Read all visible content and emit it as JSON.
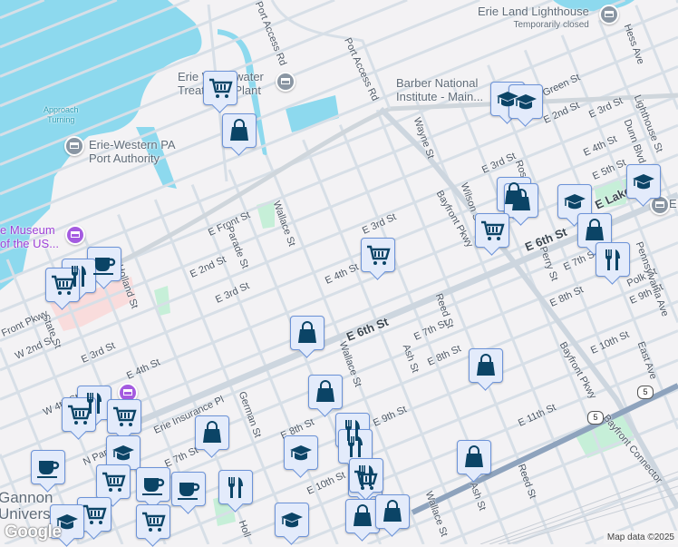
{
  "streets": [
    "Port Access Rd",
    "Port Access Rd",
    "E Front St",
    "Parade St",
    "Wallace St",
    "E 2nd St",
    "E 3rd St",
    "E 4th St",
    "E 3rd St",
    "Holland St",
    "State St",
    "W 2nd St",
    "E 3rd St",
    "E 4th St",
    "Erie Insurance Pl",
    "E 6th St",
    "German St",
    "E 8th St",
    "E 7th St",
    "Wallace St",
    "Ash St",
    "Reed St",
    "E 7th St",
    "E 8th St",
    "E 9th St",
    "E 10th St",
    "E 11th St",
    "Wayne St",
    "Wilson St",
    "Ross St",
    "Bayfront Pkwy",
    "E 6th St",
    "Perry St",
    "E 7th St",
    "E 8th St",
    "Polk St",
    "E 9th St",
    "E 10th St",
    "Bayfront Pkwy",
    "East Ave",
    "Bayfront Connector",
    "Reed St",
    "Ash St",
    "Wallace St",
    "E 3rd St",
    "E 4th St",
    "E 5th St",
    "E 3rd St",
    "E 2nd St",
    "Green St",
    "Dunn Blvd",
    "Lighthouse St",
    "Hess Ave",
    "E Lake Rd",
    "Pennsylvania Ave",
    "N Park",
    "Holl",
    "Front Pkwy",
    "W 4th St"
  ],
  "places": {
    "water_plant": [
      "Erie Wastewater",
      "Treatment Plant"
    ],
    "port_authority": [
      "Erie-Western PA",
      "Port Authority"
    ],
    "approach": [
      "Approach",
      "Turning"
    ],
    "museum": [
      "e Museum",
      "of the US..."
    ],
    "barber": [
      "Barber National",
      "Institute - Main..."
    ],
    "lighthouse": "Erie Land Lighthouse",
    "lighthouse_status": "Temporarily closed",
    "gannon": [
      "Gannon",
      "University"
    ],
    "edge_e": "E"
  },
  "route_shields": [
    "5",
    "5"
  ],
  "markers": [
    "cart",
    "bag",
    "edu",
    "edu",
    "bag",
    "bag",
    "edu",
    "edu",
    "cart",
    "bag",
    "food",
    "cart",
    "coffee",
    "food",
    "cart",
    "bag",
    "bag",
    "bag",
    "food",
    "food",
    "bag",
    "edu",
    "food",
    "cart",
    "cart",
    "edu",
    "coffee",
    "cart",
    "coffee",
    "coffee",
    "food",
    "cart",
    "bag",
    "food",
    "cart",
    "bag",
    "bag",
    "edu",
    "cart",
    "edu"
  ],
  "footer": {
    "logo": "Google",
    "attribution": "Map data ©2025"
  },
  "colors": {
    "water": "#8dd9ee",
    "land": "#f3f2f4",
    "road": "#d7dfe7",
    "highway": "#8ea3bd",
    "marker_bg": "#e3ebfb",
    "marker_icon": "#0b4466",
    "park": "#c6efd8"
  }
}
